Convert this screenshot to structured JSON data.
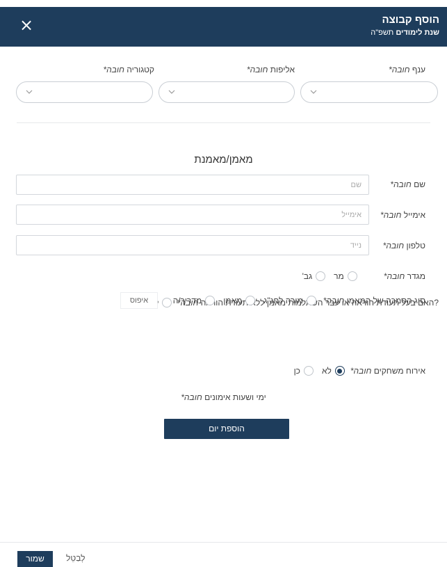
{
  "header": {
    "title": "הוסף קבוצה",
    "subtitle_bold": "שנת לימודים",
    "subtitle_value": "תשפ\"ה",
    "close_glyph": "×"
  },
  "required_text": "חובה*",
  "top_fields": {
    "branch": {
      "label": "ענף"
    },
    "championship": {
      "label": "אליפות"
    },
    "category": {
      "label": "קטגוריה"
    }
  },
  "coach_section": {
    "title": "מאמן/מאמנת",
    "name": {
      "label": "שם",
      "placeholder": "שם"
    },
    "email": {
      "label": "אימייל",
      "placeholder": "אימייל"
    },
    "phone": {
      "label": "טלפון",
      "placeholder": "נייד"
    },
    "gender": {
      "label": "מגדר",
      "options": [
        "מר",
        "גב'"
      ]
    },
    "teaching_cert": {
      "label": "?האם בעל תעודת הוראה או עבר השתלמות מאמן ללא תעודת הוראה",
      "options": [
        "לא",
        "כן"
      ]
    },
    "cert_type": {
      "label": "סוג הסמכה של המאמן",
      "options": [
        "מורה לחנ\"ג",
        "מאמן",
        "מדריך/ה"
      ],
      "reset_label": "איפוס"
    },
    "hosting_games": {
      "label": "אירוח משחקים",
      "options": [
        "לא",
        "כן"
      ],
      "selected": "לא"
    }
  },
  "schedule": {
    "label": "ימי ושעות אימונים",
    "add_day_label": "הוספת יום"
  },
  "footer": {
    "save_label": "שמור",
    "cancel_label": "לְבַטֵל"
  },
  "colors": {
    "primary": "#1e3d5c",
    "border": "#c9ced4",
    "divider": "#e6e8eb"
  }
}
